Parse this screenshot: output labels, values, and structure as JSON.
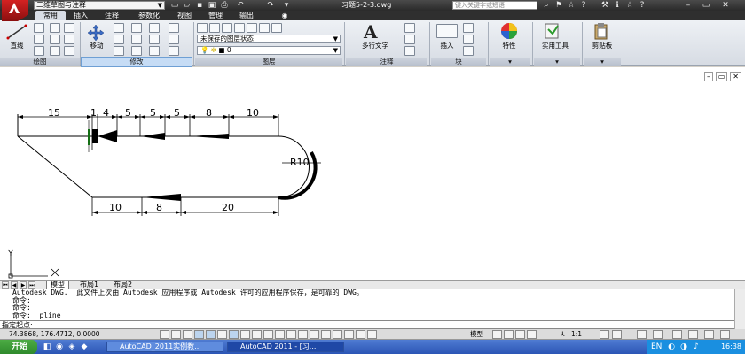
{
  "title_bar": {
    "workspace": "二维草图与注释",
    "document_title": "习题5-2-3.dwg",
    "search_placeholder": "键入关键字或短语"
  },
  "ribbon_tabs": [
    "常用",
    "插入",
    "注释",
    "参数化",
    "视图",
    "管理",
    "输出"
  ],
  "ribbon": {
    "panels": [
      "绘图",
      "修改",
      "图层",
      "注释",
      "块",
      "",
      "",
      ""
    ],
    "line_label": "直线",
    "move_label": "移动",
    "layer_state": "未保存的图层状态",
    "layer_current": "0",
    "mtext_label": "多行文字",
    "insert_label": "插入",
    "properties_label": "特性",
    "utilities_label": "实用工具",
    "clipboard_label": "剪贴板"
  },
  "drawing": {
    "dimensions": [
      "15",
      "1",
      "4",
      "5",
      "5",
      "5",
      "8",
      "10",
      "10",
      "8",
      "20"
    ],
    "radius": "R10"
  },
  "layout_tabs": [
    "模型",
    "布局1",
    "布局2"
  ],
  "command_window": {
    "lines": [
      "Autodesk DWG.  此文件上次由 Autodesk 应用程序或 Autodesk 许可的应用程序保存，是可靠的 DWG。",
      "命令:",
      "命令:",
      "命令: _pline"
    ],
    "prompt": "指定起点:"
  },
  "status_bar": {
    "coordinates": "74.3868, 176.4712, 0.0000",
    "model_label": "模型",
    "scale": "1:1"
  },
  "taskbar": {
    "start": "开始",
    "tasks": [
      "AutoCAD_2011实例教...",
      "AutoCAD 2011 - [习..."
    ],
    "clock": "16:38"
  },
  "colors": {
    "ribbon_bg": "#dfe4eb",
    "taskbar": "#2b55b5",
    "autocad_red": "#c01b1b"
  }
}
